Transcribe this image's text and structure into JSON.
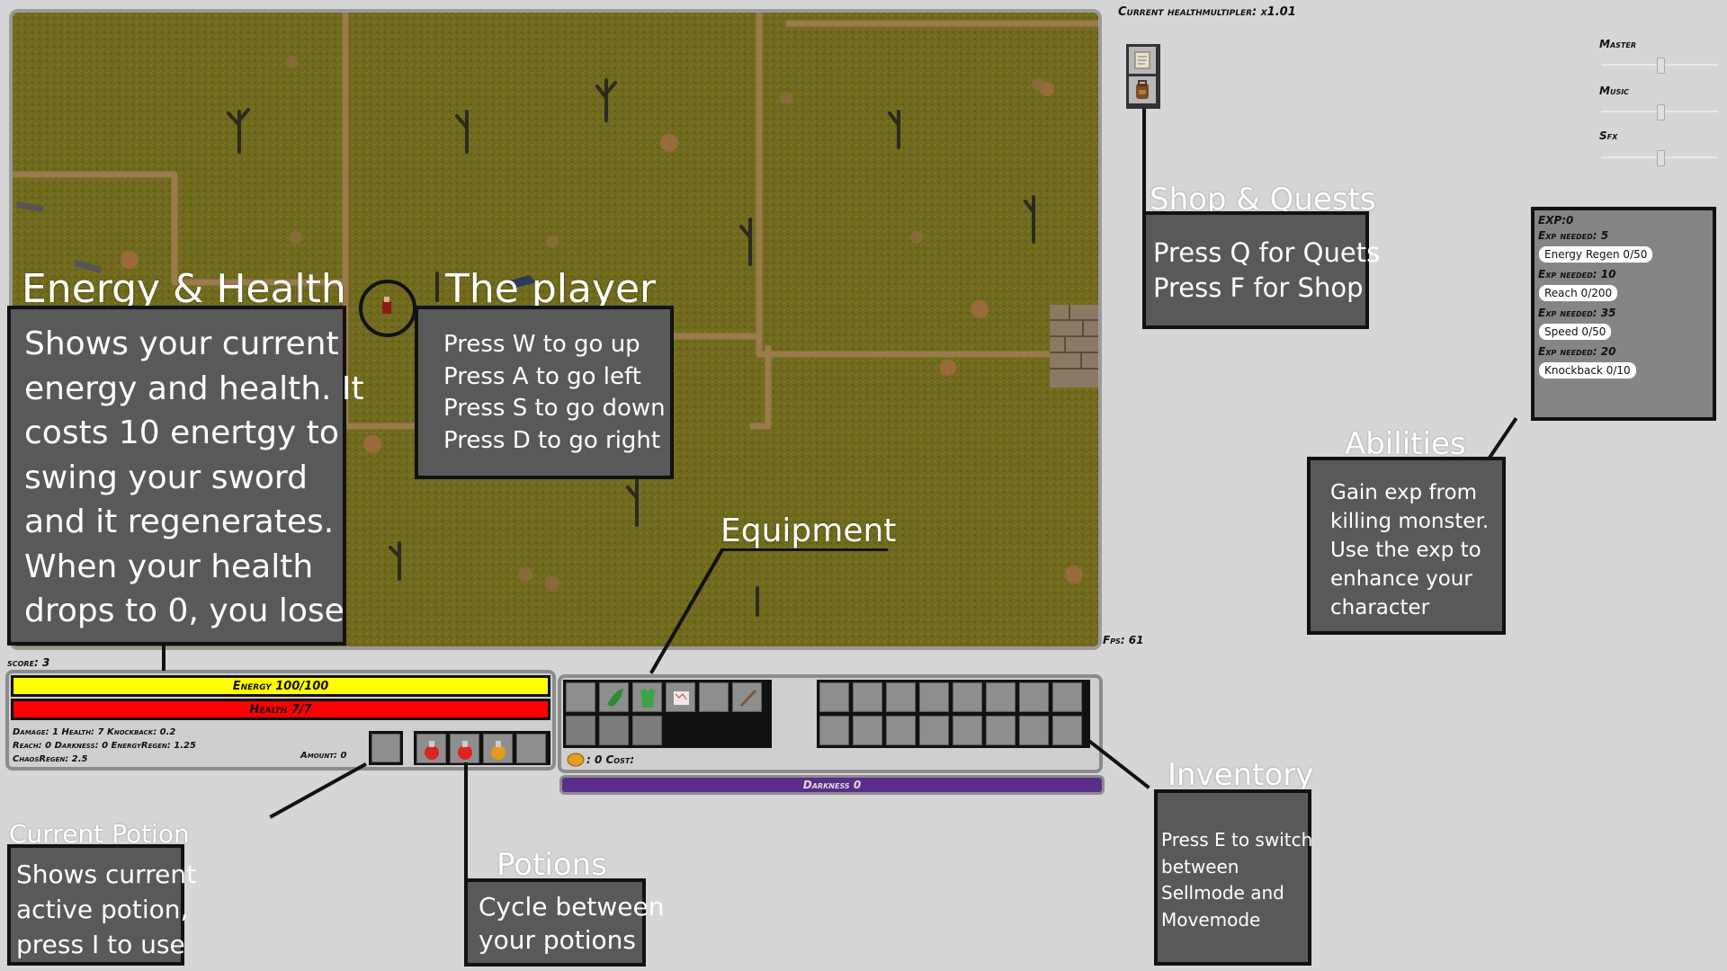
{
  "health_multiplier_label": "Current healthmultipler: x1.01",
  "fps_label": "Fps: 61",
  "score_label": "score: 3",
  "audio": {
    "master_label": "Master",
    "music_label": "Music",
    "sfx_label": "Sfx",
    "master": 0.5,
    "music": 0.5,
    "sfx": 0.5
  },
  "energy": {
    "label": "Energy 100/100",
    "fraction": 1.0,
    "color": "#ffff00"
  },
  "health": {
    "label": "Health 7/7",
    "fraction": 1.0,
    "color": "#ff0000"
  },
  "stats": {
    "line1": "Damage: 1 Health: 7 Knockback: 0.2",
    "line2": "Reach: 0 Darkness: 0 EnergyRegen: 1.25",
    "line3": "ChaosRegen: 2.5",
    "amount": "Amount: 0"
  },
  "coin_label": ": 0 Cost:",
  "darkness_label": "Darkness 0",
  "darkness_color": "#5a2d8a",
  "abilities_panel": {
    "exp": "EXP:0",
    "items": [
      {
        "need": "Exp needed: 5",
        "label": "Energy Regen 0/50"
      },
      {
        "need": "Exp needed: 10",
        "label": "Reach 0/200"
      },
      {
        "need": "Exp needed: 35",
        "label": "Speed 0/50"
      },
      {
        "need": "Exp needed: 20",
        "label": "Knockback 0/10"
      }
    ]
  },
  "tutorial": {
    "energy_health": {
      "title": "Energy & Health",
      "lines": [
        "Shows your current",
        "energy and health. It",
        "costs 10 enertgy to",
        "swing your sword",
        "and it regenerates.",
        "When your health",
        "drops to 0, you lose"
      ]
    },
    "player": {
      "title": "The player",
      "lines": [
        "Press W to go up",
        "Press A to go left",
        "Press S to go down",
        "Press D to go right"
      ]
    },
    "shop": {
      "title": "Shop & Quests",
      "lines": [
        "Press Q for Quets",
        "Press F for Shop"
      ]
    },
    "abilities": {
      "title": "Abilities",
      "lines": [
        "Gain exp from",
        "killing monster.",
        "Use the exp to",
        "enhance your",
        "character"
      ]
    },
    "equipment": {
      "title": "Equipment"
    },
    "inventory": {
      "title": "Inventory",
      "lines": [
        "Press E to switch",
        "between",
        "Sellmode and",
        "Movemode"
      ]
    },
    "current_potion": {
      "title": "Current Potion",
      "lines": [
        "Shows current",
        "active potion,",
        "press I to use"
      ]
    },
    "potions": {
      "title": "Potions",
      "lines": [
        "Cycle between",
        "your potions"
      ]
    }
  },
  "icons": {
    "quest": "scroll-icon",
    "shop": "backpack-icon",
    "boots": "green-boot-icon",
    "armor": "green-tunic-icon",
    "map": "map-icon",
    "sword": "sword-icon",
    "coin": "coin-icon",
    "potion_red": "red-potion-icon",
    "potion_orange": "orange-potion-icon"
  }
}
